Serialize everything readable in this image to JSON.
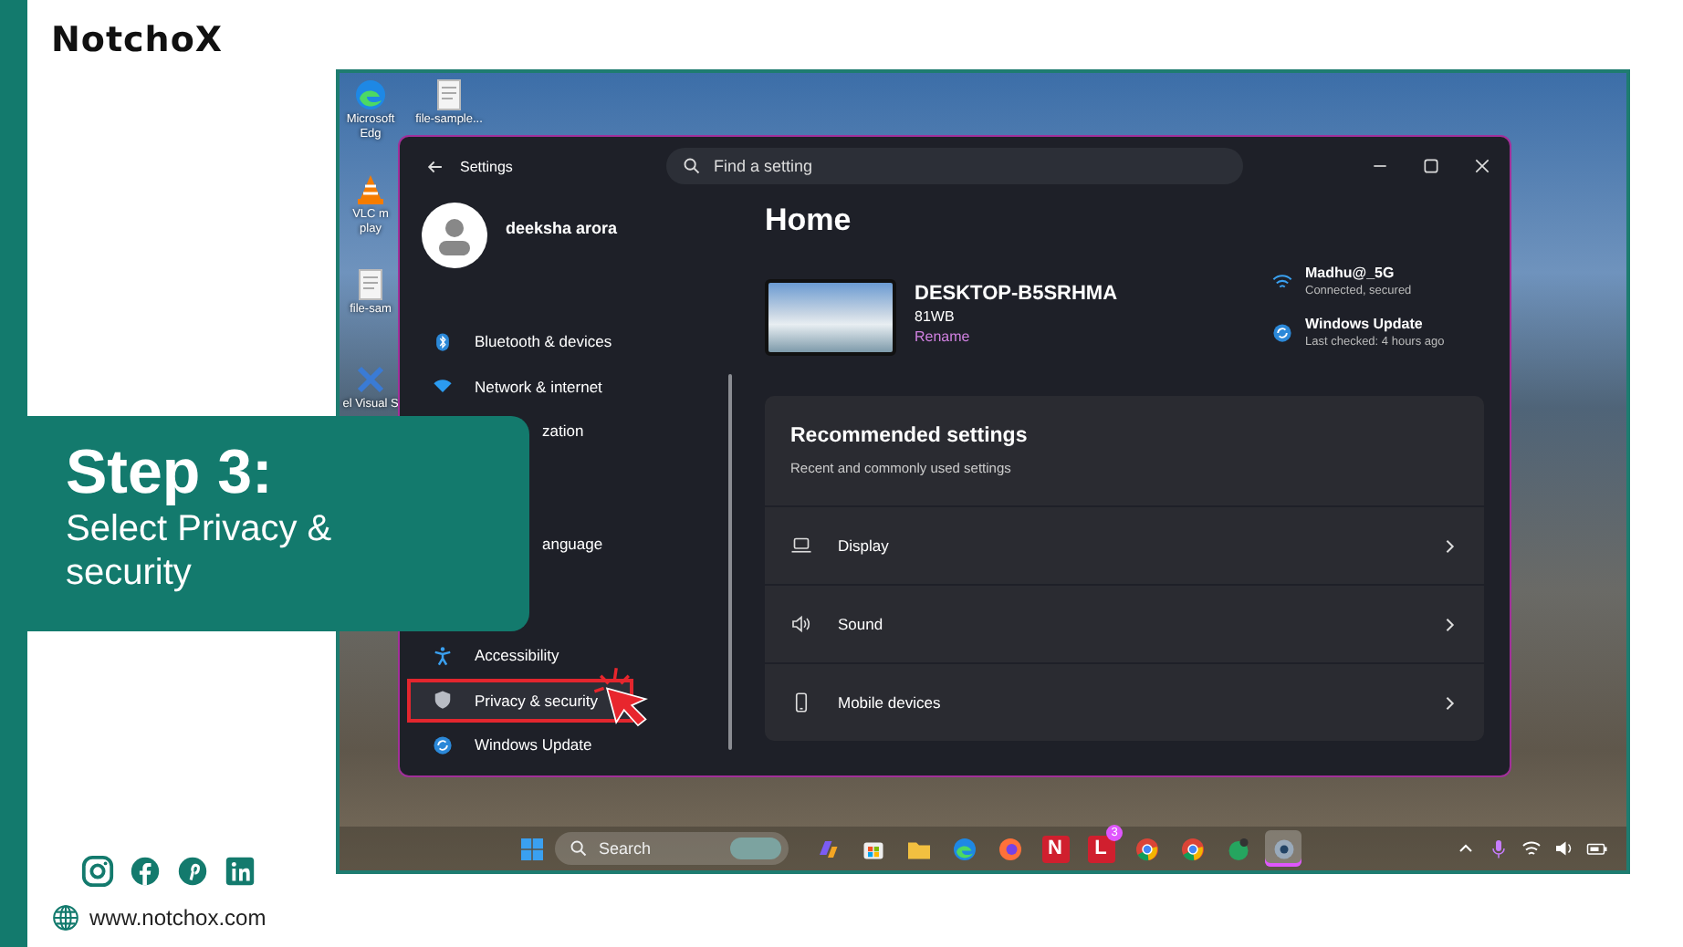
{
  "logo": "NotchoX",
  "step": {
    "title": "Step 3:",
    "subtitle": "Select Privacy & security"
  },
  "socials": [
    {
      "kind": "instagram"
    },
    {
      "kind": "facebook"
    },
    {
      "kind": "pinterest"
    },
    {
      "kind": "linkedin"
    }
  ],
  "website": "www.notchox.com",
  "desktop_icons": [
    {
      "kind": "edge",
      "label": "Microsoft Edg"
    },
    {
      "kind": "vlc",
      "label": "VLC m play"
    },
    {
      "kind": "file",
      "label": "file-sam"
    },
    {
      "kind": "vs",
      "label": "el Visual S"
    },
    {
      "kind": "file",
      "label": "file-sample..."
    }
  ],
  "settings": {
    "title": "Settings",
    "search": {
      "placeholder": "Find a setting"
    },
    "user": "deeksha arora",
    "nav": [
      {
        "kind": "bluetooth",
        "label": "Bluetooth & devices",
        "selected": false
      },
      {
        "kind": "network",
        "label": "Network & internet",
        "selected": false
      },
      {
        "kind": "partial",
        "label": "zation",
        "selected": false
      },
      {
        "kind": "partial",
        "label": "anguage",
        "selected": false
      },
      {
        "kind": "accessibility",
        "label": "Accessibility",
        "selected": false
      },
      {
        "kind": "privacy",
        "label": "Privacy & security",
        "selected": true
      },
      {
        "kind": "update",
        "label": "Windows Update",
        "selected": false
      }
    ],
    "heading": "Home",
    "device": {
      "name": "DESKTOP-B5SRHMA",
      "model": "81WB",
      "link": "Rename"
    },
    "status": [
      {
        "kind": "wifi",
        "title": "Madhu@_5G",
        "detail": "Connected, secured"
      },
      {
        "kind": "update",
        "title": "Windows Update",
        "detail": "Last checked: 4 hours ago"
      }
    ],
    "recommended": {
      "title": "Recommended settings",
      "subtitle": "Recent and commonly used settings",
      "rows": [
        {
          "kind": "display",
          "label": "Display"
        },
        {
          "kind": "sound",
          "label": "Sound"
        },
        {
          "kind": "mobile",
          "label": "Mobile devices"
        }
      ]
    }
  },
  "taskbar": {
    "search": "Search",
    "apps": [
      {
        "kind": "copilot",
        "selected": false
      },
      {
        "kind": "store",
        "selected": false
      },
      {
        "kind": "folder",
        "selected": false
      },
      {
        "kind": "edge",
        "selected": false
      },
      {
        "kind": "firefox",
        "selected": false
      },
      {
        "kind": "letter",
        "glyph": "N",
        "selected": false
      },
      {
        "kind": "letter",
        "glyph": "L",
        "badge": "3",
        "selected": false
      },
      {
        "kind": "chrome",
        "selected": false
      },
      {
        "kind": "chrome",
        "selected": false
      },
      {
        "kind": "chat",
        "selected": false
      },
      {
        "kind": "gear",
        "selected": true
      }
    ]
  }
}
